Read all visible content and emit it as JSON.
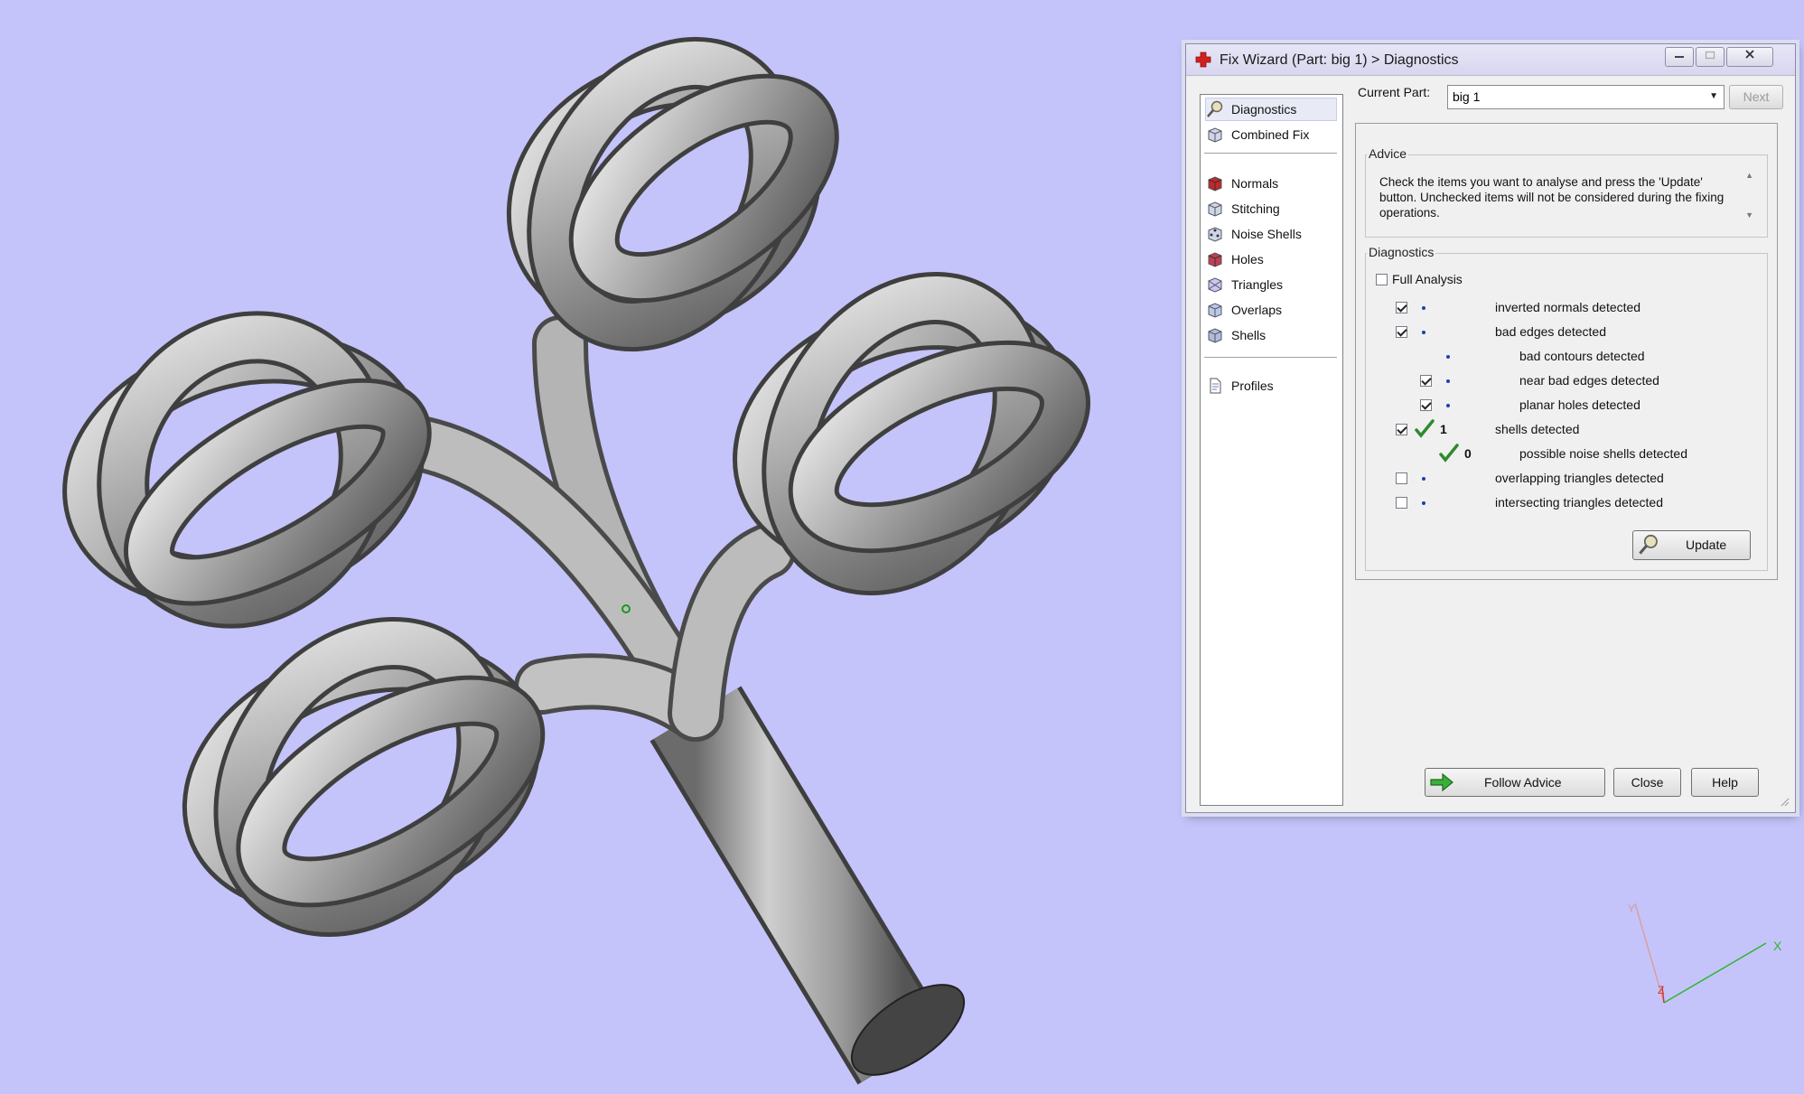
{
  "dialog": {
    "title": "Fix Wizard (Part: big 1) > Diagnostics",
    "window_buttons": [
      "minimize",
      "maximize",
      "close"
    ]
  },
  "sidebar": {
    "group1": [
      {
        "label": "Diagnostics",
        "icon": "magnifier-icon",
        "selected": true
      },
      {
        "label": "Combined Fix",
        "icon": "cube-icon"
      }
    ],
    "group2": [
      {
        "label": "Normals",
        "icon": "normals-cube-icon"
      },
      {
        "label": "Stitching",
        "icon": "stitching-cube-icon"
      },
      {
        "label": "Noise Shells",
        "icon": "noise-shells-cube-icon"
      },
      {
        "label": "Holes",
        "icon": "holes-cube-icon"
      },
      {
        "label": "Triangles",
        "icon": "triangles-cube-icon"
      },
      {
        "label": "Overlaps",
        "icon": "overlaps-cube-icon"
      },
      {
        "label": "Shells",
        "icon": "shells-cube-icon"
      }
    ],
    "group3": [
      {
        "label": "Profiles",
        "icon": "document-icon"
      }
    ]
  },
  "current_part": {
    "label": "Current Part:",
    "value": "big 1",
    "next_label": "Next"
  },
  "advice": {
    "legend": "Advice",
    "text": "Check the items you want to analyse and press the 'Update' button. Unchecked items will not be considered during the fixing operations."
  },
  "diagnostics": {
    "legend": "Diagnostics",
    "full_analysis_label": "Full Analysis",
    "full_analysis_checked": false,
    "items": [
      {
        "label": "inverted normals detected",
        "checked": true,
        "status": "dot",
        "indent": 0
      },
      {
        "label": "bad edges detected",
        "checked": true,
        "status": "dot",
        "indent": 0
      },
      {
        "label": "bad contours detected",
        "checked": null,
        "status": "dot",
        "indent": 1
      },
      {
        "label": "near bad edges detected",
        "checked": true,
        "status": "dot",
        "indent": 1
      },
      {
        "label": "planar holes detected",
        "checked": true,
        "status": "dot",
        "indent": 1
      },
      {
        "label": "shells detected",
        "checked": true,
        "status": "ok",
        "count": "1",
        "indent": 0
      },
      {
        "label": "possible noise shells detected",
        "checked": null,
        "status": "ok",
        "count": "0",
        "indent": 1
      },
      {
        "label": "overlapping triangles detected",
        "checked": false,
        "status": "dot",
        "indent": 0
      },
      {
        "label": "intersecting triangles detected",
        "checked": false,
        "status": "dot",
        "indent": 0
      }
    ],
    "update_label": "Update"
  },
  "footer": {
    "follow_advice_label": "Follow Advice",
    "close_label": "Close",
    "help_label": "Help"
  },
  "axis_labels": {
    "x": "X",
    "y": "Y",
    "z": "Z"
  },
  "colors": {
    "viewport_bg": "#c4c4fa",
    "ok_green": "#2e8a2e",
    "status_dot": "#1c3fb0",
    "normals_red": "#c0282a"
  }
}
